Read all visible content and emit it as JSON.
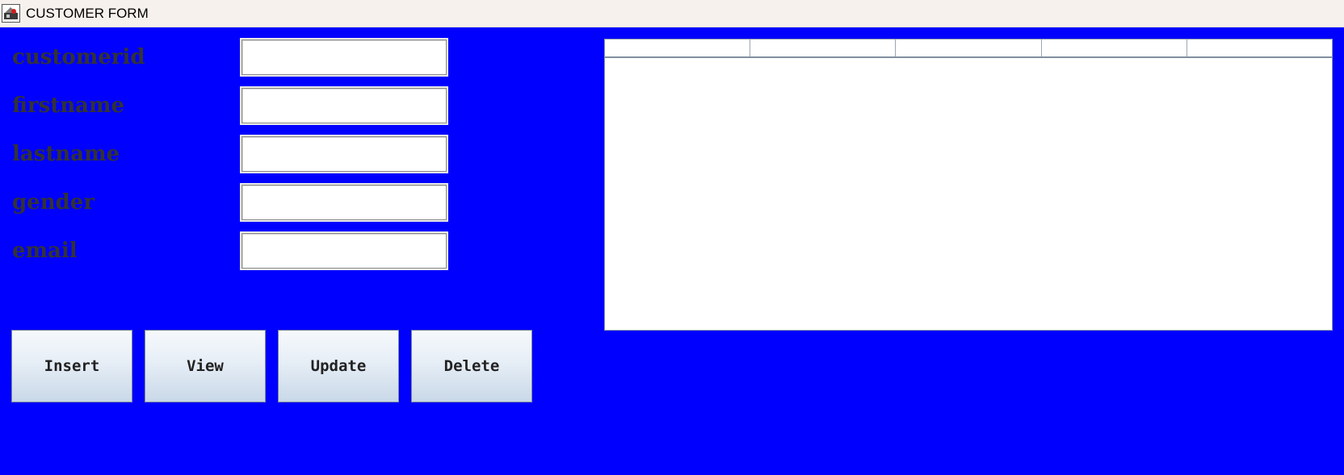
{
  "window": {
    "title": "CUSTOMER FORM",
    "icon": "java-app-icon"
  },
  "form": {
    "fields": [
      {
        "label": "customerid",
        "value": "",
        "placeholder": ""
      },
      {
        "label": "firstname",
        "value": "",
        "placeholder": ""
      },
      {
        "label": "lastname",
        "value": "",
        "placeholder": ""
      },
      {
        "label": "gender",
        "value": "",
        "placeholder": ""
      },
      {
        "label": "email",
        "value": "",
        "placeholder": ""
      }
    ]
  },
  "buttons": {
    "insert": "Insert",
    "view": "View",
    "update": "Update",
    "delete": "Delete"
  },
  "table": {
    "columns": [
      "",
      "",
      "",
      "",
      ""
    ],
    "rows": []
  },
  "colors": {
    "background": "#0000ff",
    "label_text": "#333333",
    "titlebar": "#f6f1ec"
  }
}
